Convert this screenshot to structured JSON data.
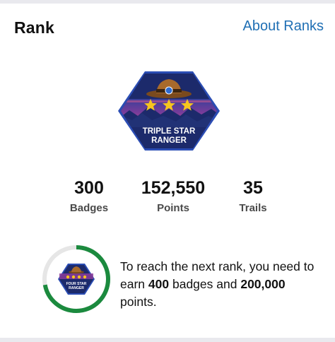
{
  "header": {
    "title": "Rank",
    "about_link": "About Ranks"
  },
  "current_rank": {
    "badge_text_line1": "TRIPLE STAR",
    "badge_text_line2": "RANGER",
    "stars": 3,
    "icon": "ranger-hat-badge"
  },
  "stats": [
    {
      "value": "300",
      "label": "Badges"
    },
    {
      "value": "152,550",
      "label": "Points"
    },
    {
      "value": "35",
      "label": "Trails"
    }
  ],
  "next_rank": {
    "badge_text_line1": "FOUR STAR",
    "badge_text_line2": "RANGER",
    "stars": 4,
    "progress_fraction": 0.72,
    "text_prefix": "To reach the next rank, you need to earn",
    "badges_needed": "400",
    "text_middle": "badges and",
    "points_needed": "200,000",
    "text_suffix": "points."
  },
  "colors": {
    "link": "#1f6fb4",
    "progress": "#1b8a3e",
    "progress_track": "#e6e6e6",
    "badge_navy": "#1c2a6b",
    "badge_border": "#2b4db4",
    "star": "#f7c51e"
  }
}
